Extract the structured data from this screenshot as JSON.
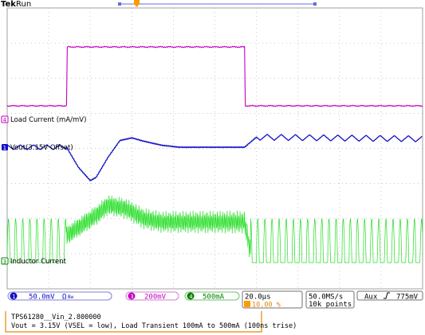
{
  "chart_data": {
    "type": "line",
    "title": "",
    "xlabel": "",
    "ylabel": "",
    "grid": true,
    "header": {
      "brand": "Tek",
      "state": "Run"
    },
    "horizontal_scale": "20.0µs",
    "trigger_position": "10.00 %",
    "sample_rate": "50.0MS/s",
    "record_length": "10k points",
    "trigger": {
      "source": "Aux",
      "slope": "rising",
      "level": "775mV"
    },
    "channels": [
      {
        "number": "1",
        "scale": "50.0mV",
        "coupling_symbol": "Ω",
        "bw_symbol": "Bw",
        "color": "#1010c8"
      },
      {
        "number": "3",
        "scale": "200mV",
        "color": "#c000c0"
      },
      {
        "number": "4",
        "scale": "500mA",
        "color": "#008000"
      }
    ],
    "series": [
      {
        "name": "Load Current (mA/mV)",
        "channel": "3",
        "color": "#c000c0",
        "x": [
          -40,
          -20,
          -20,
          40,
          40,
          100
        ],
        "y": [
          100,
          100,
          500,
          500,
          100,
          100
        ]
      },
      {
        "name": "Vout(3.15V Offset)",
        "channel": "1",
        "color": "#1010c8",
        "x": [
          -20,
          -16,
          -12,
          -10,
          -6,
          -2,
          2,
          6,
          12,
          18,
          24,
          30,
          40,
          44,
          100
        ],
        "y": [
          0,
          -60,
          -100,
          -90,
          -30,
          20,
          28,
          18,
          6,
          0,
          0,
          0,
          0,
          30,
          25
        ]
      },
      {
        "name": "Inductor Current",
        "channel": "4",
        "color": "#22dd22",
        "x": [
          -40,
          -20,
          -10,
          -6,
          0,
          6,
          12,
          20,
          30,
          40,
          42,
          100
        ],
        "y": [
          200,
          400,
          700,
          850,
          800,
          650,
          600,
          600,
          600,
          600,
          150,
          200
        ]
      }
    ],
    "note": {
      "line1": "TPS61280__Vin_2.800000",
      "line2": "Vout = 3.15V (VSEL = low), Load Transient 100mA to 500mA (100ns trise)"
    }
  }
}
